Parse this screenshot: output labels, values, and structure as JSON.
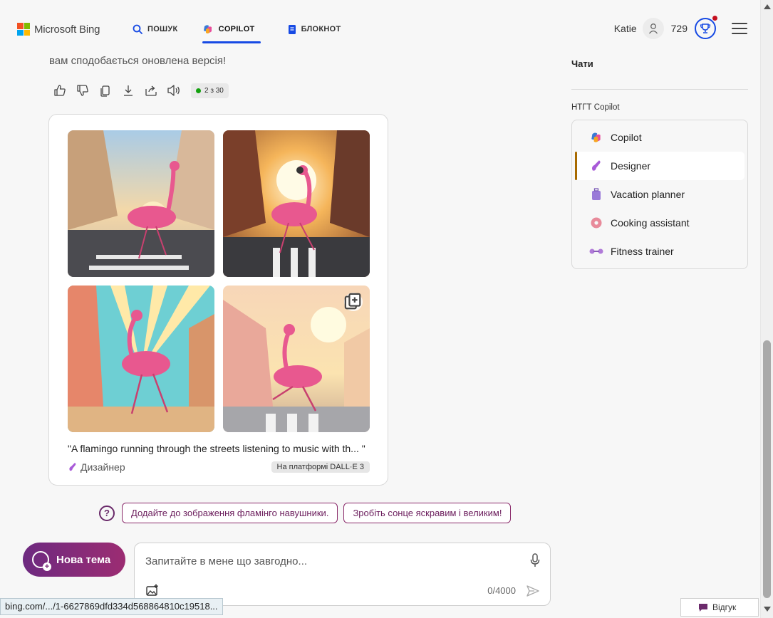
{
  "header": {
    "logo_text": "Microsoft Bing",
    "nav": {
      "search_label": "ПОШУК",
      "copilot_label": "COPILOT",
      "notebook_label": "БЛОКНОТ"
    },
    "user_name": "Katie",
    "points": "729"
  },
  "chat": {
    "previous_text": "вам сподобається оновлена версія!",
    "response_counter": "2 з 30",
    "image_card": {
      "prompt": "\"A flamingo running through the streets listening to music with th... \"",
      "creator": "Дизайнер",
      "platform_badge": "На платформі DALL·E 3"
    },
    "suggestions": [
      "Додайте до зображення фламінго навушники.",
      "Зробіть сонце яскравим і великим!"
    ]
  },
  "composer": {
    "new_topic_label": "Нова тема",
    "placeholder": "Запитайте в мене що завгодно...",
    "char_count": "0/4000"
  },
  "sidebar": {
    "title": "Чати",
    "gpt_section_label": "НТГТ Copilot",
    "gpts": [
      {
        "label": "Copilot",
        "icon": "copilot-icon"
      },
      {
        "label": "Designer",
        "icon": "designer-icon"
      },
      {
        "label": "Vacation planner",
        "icon": "suitcase-icon"
      },
      {
        "label": "Cooking assistant",
        "icon": "donut-icon"
      },
      {
        "label": "Fitness trainer",
        "icon": "dumbbell-icon"
      }
    ],
    "active_gpt": "Designer"
  },
  "status_bar": {
    "url": "bing.com/.../1-6627869dfd334d568864810c19518..."
  },
  "feedback_label": "Відгук",
  "colors": {
    "accent_blue": "#174ae4",
    "copilot_purple": "#7a2a7a",
    "active_marker": "#a86a00"
  }
}
